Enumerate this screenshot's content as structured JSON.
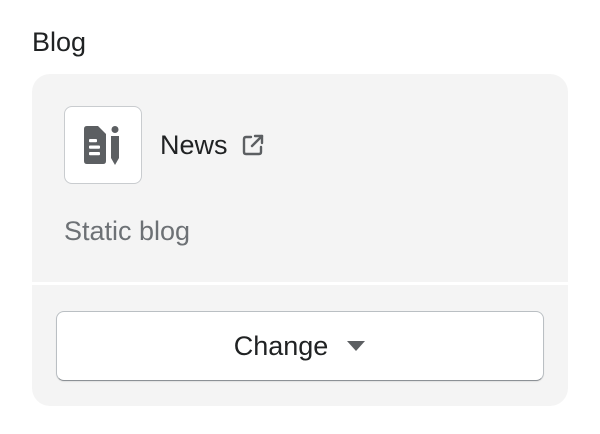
{
  "section": {
    "title": "Blog"
  },
  "blog_card": {
    "icon": "blog-post-icon",
    "name": "News",
    "link_icon": "external-link-icon",
    "subtitle": "Static blog",
    "change_button_label": "Change",
    "change_button_icon": "caret-down-icon"
  },
  "colors": {
    "card_background": "#f4f4f4",
    "text_primary": "#202223",
    "text_secondary": "#6d7175",
    "icon": "#5c5f62"
  }
}
